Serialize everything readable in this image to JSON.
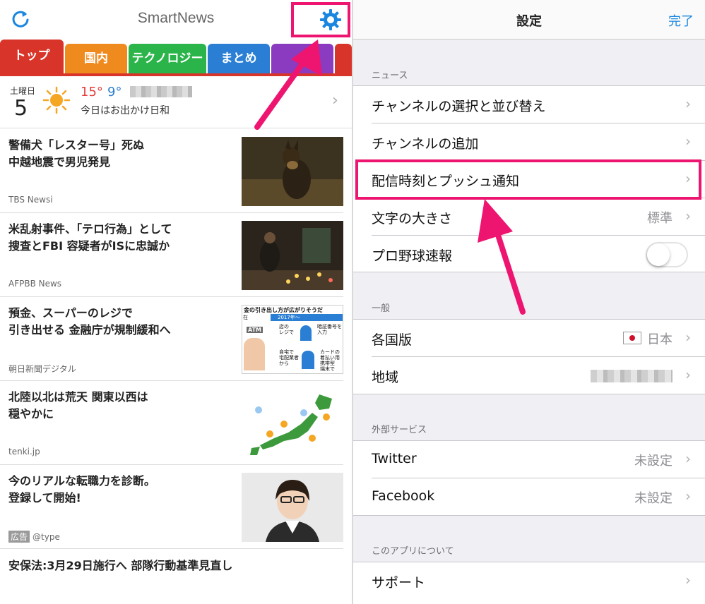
{
  "left": {
    "app_title": "SmartNews",
    "tabs": [
      {
        "label": "トップ",
        "color": "#d8342a"
      },
      {
        "label": "国内",
        "color": "#ef8a1f"
      },
      {
        "label": "テクノロジー",
        "color": "#2bb44a"
      },
      {
        "label": "まとめ",
        "color": "#2a7fd4"
      },
      {
        "label": "",
        "color": "#8a3bbf"
      },
      {
        "label": "",
        "color": "#d8342a"
      }
    ],
    "weather": {
      "day": "土曜日",
      "date": "5",
      "high": "15°",
      "low": "9°",
      "forecast": "今日はお出かけ日和"
    },
    "articles": [
      {
        "title": "警備犬「レスター号」死ぬ\n中越地震で男児発見",
        "source": "TBS Newsi",
        "thumb": "dog"
      },
      {
        "title": "米乱射事件、「テロ行為」として\n捜査とFBI 容疑者がISに忠誠か",
        "source": "AFPBB News",
        "thumb": "candles"
      },
      {
        "title": "預金、スーパーのレジで\n引き出せる 金融庁が規制緩和へ",
        "source": "朝日新聞デジタル",
        "thumb": "infographic"
      },
      {
        "title": "北陸以北は荒天 関東以西は\n穏やかに",
        "source": "tenki.jp",
        "thumb": "map"
      },
      {
        "title": "今のリアルな転職力を診断。\n登録して開始!",
        "source": "@type",
        "ad_badge": "広告",
        "thumb": "person"
      }
    ],
    "last_title": "安保法:3月29日施行へ 部隊行動基準見直し",
    "infographic": {
      "header": "金の引き出し方が広がりそうだ",
      "year": "2017年～",
      "col": "在",
      "atm": "ATM",
      "store": "店の\nレジで",
      "pin": "暗証番号を\n入力",
      "home": "自宅で\n宅配業者\nから",
      "card": "カードの\n着払い用\n携帯型\n端末で"
    }
  },
  "right": {
    "title": "設定",
    "done": "完了",
    "sections": [
      {
        "header": "ニュース",
        "rows": [
          {
            "label": "チャンネルの選択と並び替え",
            "value": "",
            "type": "chevron"
          },
          {
            "label": "チャンネルの追加",
            "value": "",
            "type": "chevron"
          },
          {
            "label": "配信時刻とプッシュ通知",
            "value": "",
            "type": "chevron"
          },
          {
            "label": "文字の大きさ",
            "value": "標準",
            "type": "chevron"
          },
          {
            "label": "プロ野球速報",
            "value": "",
            "type": "toggle"
          }
        ]
      },
      {
        "header": "一般",
        "rows": [
          {
            "label": "各国版",
            "value": "日本",
            "type": "flag"
          },
          {
            "label": "地域",
            "value": "",
            "type": "blur"
          }
        ]
      },
      {
        "header": "外部サービス",
        "rows": [
          {
            "label": "Twitter",
            "value": "未設定",
            "type": "chevron"
          },
          {
            "label": "Facebook",
            "value": "未設定",
            "type": "chevron"
          }
        ]
      },
      {
        "header": "このアプリについて",
        "rows": [
          {
            "label": "サポート",
            "value": "",
            "type": "chevron"
          }
        ]
      }
    ]
  },
  "colors": {
    "accent_pink": "#ee1570",
    "done_blue": "#1a86e0",
    "gear_blue": "#1a86e0"
  }
}
